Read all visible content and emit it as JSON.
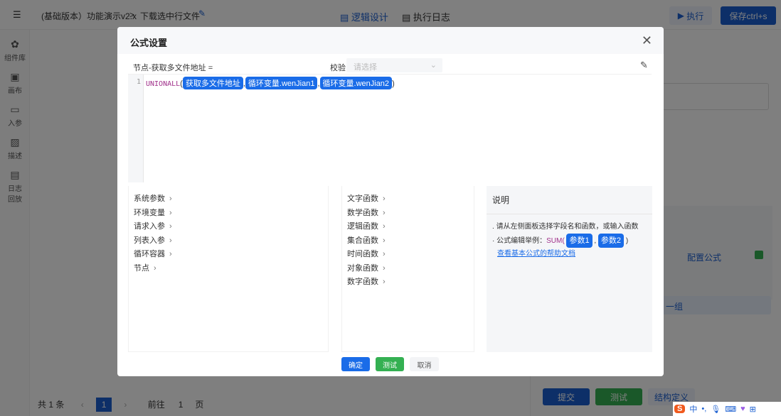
{
  "header": {
    "project": "(基础版本）功能演示v2.x",
    "separator": ">",
    "page": "下载选中行文件",
    "tabs": [
      {
        "label": "逻辑设计",
        "active": true
      },
      {
        "label": "执行日志",
        "active": false
      }
    ],
    "run_label": "执行",
    "save_label": "保存ctrl+s"
  },
  "sidebar": {
    "items": [
      {
        "label": "组件库",
        "icon": "puzzle-icon"
      },
      {
        "label": "画布",
        "icon": "canvas-icon"
      },
      {
        "label": "入参",
        "icon": "input-icon"
      },
      {
        "label": "描述",
        "icon": "description-icon"
      },
      {
        "label": "日志回放",
        "icon": "log-icon"
      }
    ]
  },
  "background": {
    "configure_formula": "配置公式",
    "group_label": "一组",
    "submit": "提交",
    "test": "测试",
    "struct_def": "结构定义"
  },
  "pagination": {
    "total": "共 1 条",
    "current": "1",
    "goto": "前往",
    "page_input": "1",
    "page_suffix": "页"
  },
  "modal": {
    "title": "公式设置",
    "target_label": "节点-获取多文件地址  =",
    "validate_label": "校验",
    "validate_placeholder": "请选择",
    "line_number": "1",
    "formula": {
      "func": "UNIONALL",
      "open": "(",
      "close": ")",
      "sep": ",",
      "args": [
        "获取多文件地址",
        "循环变量.wenJian1",
        "循环变量.wenJian2"
      ]
    },
    "fields": [
      "系统参数",
      "环境变量",
      "请求入参",
      "列表入参",
      "循环容器",
      "节点"
    ],
    "functions": [
      "文字函数",
      "数学函数",
      "逻辑函数",
      "集合函数",
      "时间函数",
      "对象函数",
      "数字函数"
    ],
    "help": {
      "title": "说明",
      "line1": "请从左侧面板选择字段名和函数，或输入函数",
      "line2_prefix": "公式编辑举例：",
      "example_func": "SUM(",
      "example_args": [
        "参数1",
        "参数2"
      ],
      "example_sep": ",",
      "example_close": ")",
      "link": "查看基本公式的帮助文档"
    },
    "buttons": {
      "ok": "确定",
      "test": "测试",
      "cancel": "取消"
    }
  },
  "colors": {
    "primary": "#1a6ce8",
    "success": "#34b052",
    "function": "#a0308a"
  }
}
